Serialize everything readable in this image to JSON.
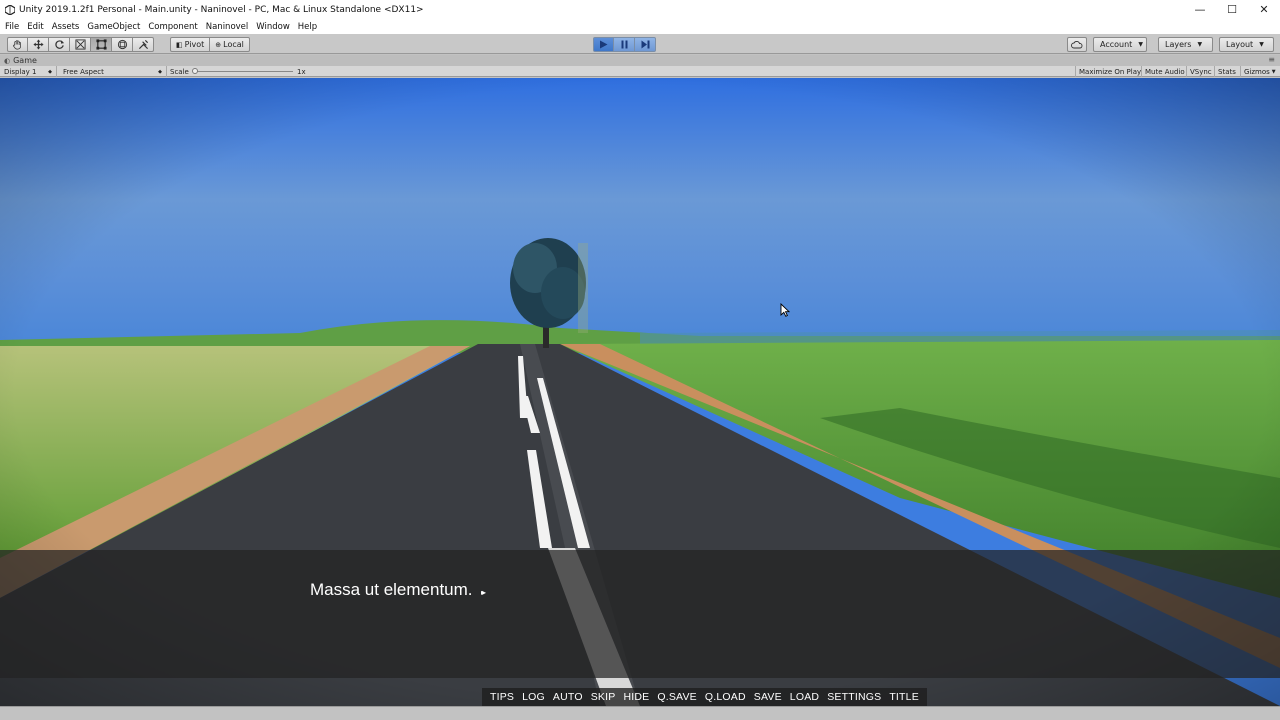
{
  "window": {
    "title": "Unity 2019.1.2f1 Personal - Main.unity - Naninovel - PC, Mac & Linux Standalone <DX11>",
    "controls": {
      "minimize": "—",
      "maximize": "☐",
      "close": "✕"
    }
  },
  "menu": {
    "items": [
      {
        "label": "File"
      },
      {
        "label": "Edit"
      },
      {
        "label": "Assets"
      },
      {
        "label": "GameObject"
      },
      {
        "label": "Component"
      },
      {
        "label": "Naninovel"
      },
      {
        "label": "Window"
      },
      {
        "label": "Help"
      }
    ]
  },
  "toolbar": {
    "tools": [
      "hand-icon",
      "move-icon",
      "rotate-icon",
      "scale-icon",
      "rect-icon",
      "transform-icon",
      "custom-tool-icon"
    ],
    "pivot_label": "Pivot",
    "local_label": "Local",
    "account_label": "Account",
    "layers_label": "Layers",
    "layout_label": "Layout"
  },
  "game_tab": {
    "label": "Game"
  },
  "game_toolbar": {
    "display": "Display 1",
    "aspect": "Free Aspect",
    "scale_label": "Scale",
    "scale_value": "1x",
    "scale_level": 0,
    "toggles": {
      "maximize": "Maximize On Play",
      "mute": "Mute Audio",
      "vsync": "VSync",
      "stats": "Stats",
      "gizmos": "Gizmos"
    }
  },
  "dialogue": {
    "text": "Massa ut elementum.",
    "continue_glyph": "▸▸"
  },
  "controls": {
    "buttons": [
      {
        "label": "TIPS"
      },
      {
        "label": "LOG"
      },
      {
        "label": "AUTO"
      },
      {
        "label": "SKIP"
      },
      {
        "label": "HIDE"
      },
      {
        "label": "Q.SAVE"
      },
      {
        "label": "Q.LOAD"
      },
      {
        "label": "SAVE"
      },
      {
        "label": "LOAD"
      },
      {
        "label": "SETTINGS"
      },
      {
        "label": "TITLE"
      }
    ]
  },
  "colors": {
    "play_accent": "#3f77c9",
    "sky": "#3d7de0",
    "grass": "#5f9a3a",
    "road": "#3a3d42"
  }
}
